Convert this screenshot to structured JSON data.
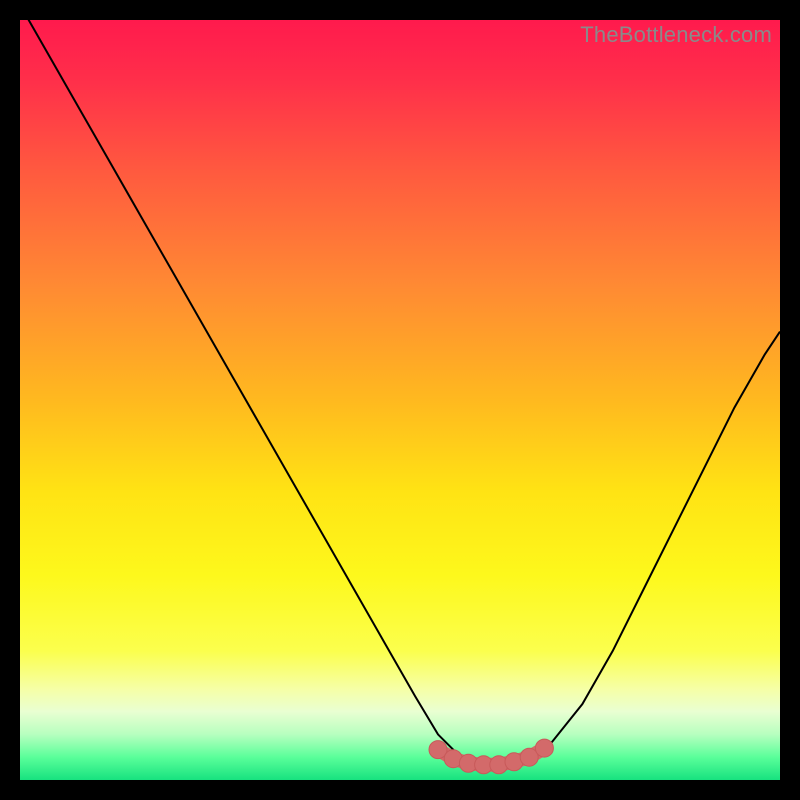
{
  "watermark": "TheBottleneck.com",
  "colors": {
    "background": "#000000",
    "gradient_stops": [
      {
        "offset": 0.0,
        "color": "#ff1a4d"
      },
      {
        "offset": 0.08,
        "color": "#ff2f4a"
      },
      {
        "offset": 0.2,
        "color": "#ff5a3f"
      },
      {
        "offset": 0.35,
        "color": "#ff8a33"
      },
      {
        "offset": 0.5,
        "color": "#ffb91f"
      },
      {
        "offset": 0.62,
        "color": "#ffe314"
      },
      {
        "offset": 0.73,
        "color": "#fdf81c"
      },
      {
        "offset": 0.83,
        "color": "#fbff4d"
      },
      {
        "offset": 0.88,
        "color": "#f6ffa6"
      },
      {
        "offset": 0.91,
        "color": "#e9ffd2"
      },
      {
        "offset": 0.94,
        "color": "#b7ffbf"
      },
      {
        "offset": 0.97,
        "color": "#5aff9a"
      },
      {
        "offset": 1.0,
        "color": "#17e27f"
      }
    ],
    "curve_stroke": "#000000",
    "marker_fill": "#d36a6a",
    "marker_stroke": "#c85a5a"
  },
  "chart_data": {
    "type": "line",
    "title": "",
    "xlabel": "",
    "ylabel": "",
    "xlim": [
      0,
      100
    ],
    "ylim": [
      0,
      100
    ],
    "series": [
      {
        "name": "bottleneck-curve",
        "x": [
          0,
          4,
          8,
          12,
          16,
          20,
          24,
          28,
          32,
          36,
          40,
          44,
          48,
          52,
          55,
          58,
          60,
          63,
          66,
          70,
          74,
          78,
          82,
          86,
          90,
          94,
          98,
          100
        ],
        "y": [
          102,
          95,
          88,
          81,
          74,
          67,
          60,
          53,
          46,
          39,
          32,
          25,
          18,
          11,
          6,
          3,
          2,
          2,
          3,
          5,
          10,
          17,
          25,
          33,
          41,
          49,
          56,
          59
        ]
      }
    ],
    "markers": {
      "name": "optimal-zone-markers",
      "x": [
        55,
        57,
        59,
        61,
        63,
        65,
        67,
        69
      ],
      "y": [
        4.0,
        2.8,
        2.2,
        2.0,
        2.0,
        2.4,
        3.0,
        4.2
      ]
    }
  }
}
